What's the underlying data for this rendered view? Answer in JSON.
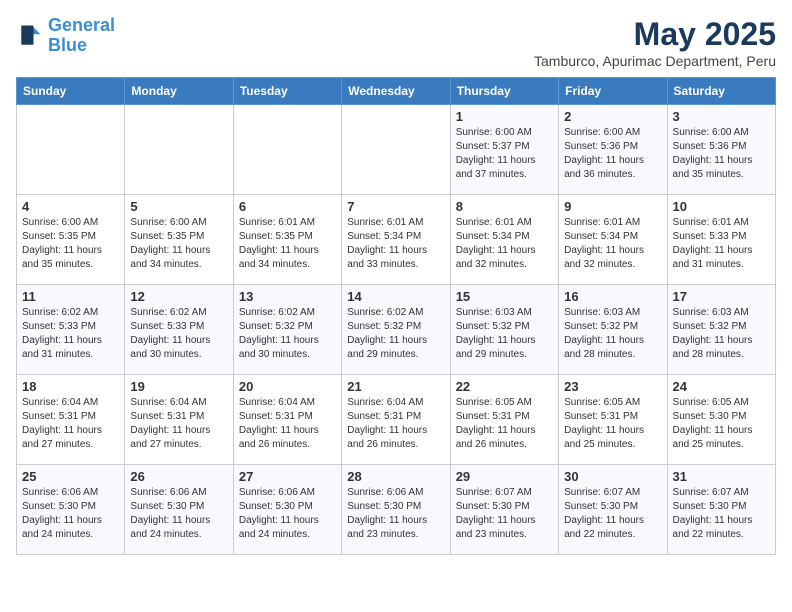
{
  "logo": {
    "line1": "General",
    "line2": "Blue"
  },
  "header": {
    "month": "May 2025",
    "location": "Tamburco, Apurimac Department, Peru"
  },
  "days_of_week": [
    "Sunday",
    "Monday",
    "Tuesday",
    "Wednesday",
    "Thursday",
    "Friday",
    "Saturday"
  ],
  "weeks": [
    [
      {
        "day": "",
        "sunrise": "",
        "sunset": "",
        "daylight": ""
      },
      {
        "day": "",
        "sunrise": "",
        "sunset": "",
        "daylight": ""
      },
      {
        "day": "",
        "sunrise": "",
        "sunset": "",
        "daylight": ""
      },
      {
        "day": "",
        "sunrise": "",
        "sunset": "",
        "daylight": ""
      },
      {
        "day": "1",
        "sunrise": "Sunrise: 6:00 AM",
        "sunset": "Sunset: 5:37 PM",
        "daylight": "Daylight: 11 hours and 37 minutes."
      },
      {
        "day": "2",
        "sunrise": "Sunrise: 6:00 AM",
        "sunset": "Sunset: 5:36 PM",
        "daylight": "Daylight: 11 hours and 36 minutes."
      },
      {
        "day": "3",
        "sunrise": "Sunrise: 6:00 AM",
        "sunset": "Sunset: 5:36 PM",
        "daylight": "Daylight: 11 hours and 35 minutes."
      }
    ],
    [
      {
        "day": "4",
        "sunrise": "Sunrise: 6:00 AM",
        "sunset": "Sunset: 5:35 PM",
        "daylight": "Daylight: 11 hours and 35 minutes."
      },
      {
        "day": "5",
        "sunrise": "Sunrise: 6:00 AM",
        "sunset": "Sunset: 5:35 PM",
        "daylight": "Daylight: 11 hours and 34 minutes."
      },
      {
        "day": "6",
        "sunrise": "Sunrise: 6:01 AM",
        "sunset": "Sunset: 5:35 PM",
        "daylight": "Daylight: 11 hours and 34 minutes."
      },
      {
        "day": "7",
        "sunrise": "Sunrise: 6:01 AM",
        "sunset": "Sunset: 5:34 PM",
        "daylight": "Daylight: 11 hours and 33 minutes."
      },
      {
        "day": "8",
        "sunrise": "Sunrise: 6:01 AM",
        "sunset": "Sunset: 5:34 PM",
        "daylight": "Daylight: 11 hours and 32 minutes."
      },
      {
        "day": "9",
        "sunrise": "Sunrise: 6:01 AM",
        "sunset": "Sunset: 5:34 PM",
        "daylight": "Daylight: 11 hours and 32 minutes."
      },
      {
        "day": "10",
        "sunrise": "Sunrise: 6:01 AM",
        "sunset": "Sunset: 5:33 PM",
        "daylight": "Daylight: 11 hours and 31 minutes."
      }
    ],
    [
      {
        "day": "11",
        "sunrise": "Sunrise: 6:02 AM",
        "sunset": "Sunset: 5:33 PM",
        "daylight": "Daylight: 11 hours and 31 minutes."
      },
      {
        "day": "12",
        "sunrise": "Sunrise: 6:02 AM",
        "sunset": "Sunset: 5:33 PM",
        "daylight": "Daylight: 11 hours and 30 minutes."
      },
      {
        "day": "13",
        "sunrise": "Sunrise: 6:02 AM",
        "sunset": "Sunset: 5:32 PM",
        "daylight": "Daylight: 11 hours and 30 minutes."
      },
      {
        "day": "14",
        "sunrise": "Sunrise: 6:02 AM",
        "sunset": "Sunset: 5:32 PM",
        "daylight": "Daylight: 11 hours and 29 minutes."
      },
      {
        "day": "15",
        "sunrise": "Sunrise: 6:03 AM",
        "sunset": "Sunset: 5:32 PM",
        "daylight": "Daylight: 11 hours and 29 minutes."
      },
      {
        "day": "16",
        "sunrise": "Sunrise: 6:03 AM",
        "sunset": "Sunset: 5:32 PM",
        "daylight": "Daylight: 11 hours and 28 minutes."
      },
      {
        "day": "17",
        "sunrise": "Sunrise: 6:03 AM",
        "sunset": "Sunset: 5:32 PM",
        "daylight": "Daylight: 11 hours and 28 minutes."
      }
    ],
    [
      {
        "day": "18",
        "sunrise": "Sunrise: 6:04 AM",
        "sunset": "Sunset: 5:31 PM",
        "daylight": "Daylight: 11 hours and 27 minutes."
      },
      {
        "day": "19",
        "sunrise": "Sunrise: 6:04 AM",
        "sunset": "Sunset: 5:31 PM",
        "daylight": "Daylight: 11 hours and 27 minutes."
      },
      {
        "day": "20",
        "sunrise": "Sunrise: 6:04 AM",
        "sunset": "Sunset: 5:31 PM",
        "daylight": "Daylight: 11 hours and 26 minutes."
      },
      {
        "day": "21",
        "sunrise": "Sunrise: 6:04 AM",
        "sunset": "Sunset: 5:31 PM",
        "daylight": "Daylight: 11 hours and 26 minutes."
      },
      {
        "day": "22",
        "sunrise": "Sunrise: 6:05 AM",
        "sunset": "Sunset: 5:31 PM",
        "daylight": "Daylight: 11 hours and 26 minutes."
      },
      {
        "day": "23",
        "sunrise": "Sunrise: 6:05 AM",
        "sunset": "Sunset: 5:31 PM",
        "daylight": "Daylight: 11 hours and 25 minutes."
      },
      {
        "day": "24",
        "sunrise": "Sunrise: 6:05 AM",
        "sunset": "Sunset: 5:30 PM",
        "daylight": "Daylight: 11 hours and 25 minutes."
      }
    ],
    [
      {
        "day": "25",
        "sunrise": "Sunrise: 6:06 AM",
        "sunset": "Sunset: 5:30 PM",
        "daylight": "Daylight: 11 hours and 24 minutes."
      },
      {
        "day": "26",
        "sunrise": "Sunrise: 6:06 AM",
        "sunset": "Sunset: 5:30 PM",
        "daylight": "Daylight: 11 hours and 24 minutes."
      },
      {
        "day": "27",
        "sunrise": "Sunrise: 6:06 AM",
        "sunset": "Sunset: 5:30 PM",
        "daylight": "Daylight: 11 hours and 24 minutes."
      },
      {
        "day": "28",
        "sunrise": "Sunrise: 6:06 AM",
        "sunset": "Sunset: 5:30 PM",
        "daylight": "Daylight: 11 hours and 23 minutes."
      },
      {
        "day": "29",
        "sunrise": "Sunrise: 6:07 AM",
        "sunset": "Sunset: 5:30 PM",
        "daylight": "Daylight: 11 hours and 23 minutes."
      },
      {
        "day": "30",
        "sunrise": "Sunrise: 6:07 AM",
        "sunset": "Sunset: 5:30 PM",
        "daylight": "Daylight: 11 hours and 22 minutes."
      },
      {
        "day": "31",
        "sunrise": "Sunrise: 6:07 AM",
        "sunset": "Sunset: 5:30 PM",
        "daylight": "Daylight: 11 hours and 22 minutes."
      }
    ]
  ]
}
